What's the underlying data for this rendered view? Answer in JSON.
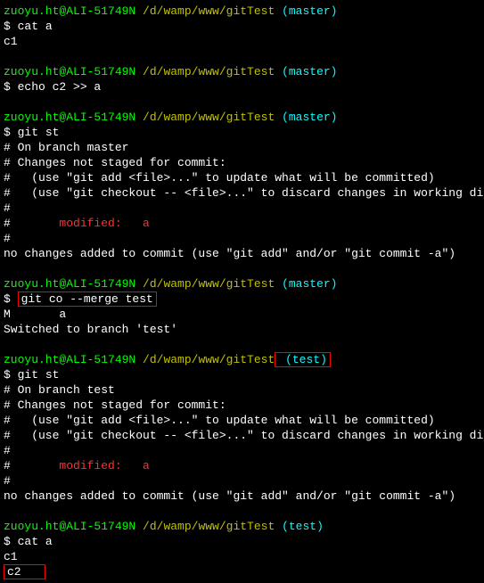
{
  "user": "zuoyu.ht@ALI-51749N",
  "path": " /d/wamp/www/gitTest",
  "branch_master": " (master)",
  "branch_test": " (test)",
  "dollar": "$ ",
  "blocks": {
    "b1": {
      "cmd": "cat a",
      "out1": "c1"
    },
    "b2": {
      "cmd": "echo c2 >> a"
    },
    "b3": {
      "cmd": "git st",
      "l1": "# On branch master",
      "l2": "# Changes not staged for commit:",
      "l3": "#   (use \"git add <file>...\" to update what will be committed)",
      "l4": "#   (use \"git checkout -- <file>...\" to discard changes in working directory)",
      "l5": "#",
      "l6_a": "#       ",
      "l6_b": "modified:   a",
      "l7": "#",
      "l8": "no changes added to commit (use \"git add\" and/or \"git commit -a\")"
    },
    "b4": {
      "cmd": "git co --merge test",
      "l1": "M       a",
      "l2": "Switched to branch 'test'"
    },
    "b5": {
      "cmd": "git st",
      "l1": "# On branch test",
      "l2": "# Changes not staged for commit:",
      "l3": "#   (use \"git add <file>...\" to update what will be committed)",
      "l4": "#   (use \"git checkout -- <file>...\" to discard changes in working directory)",
      "l5": "#",
      "l6_a": "#       ",
      "l6_b": "modified:   a",
      "l7": "#",
      "l8": "no changes added to commit (use \"git add\" and/or \"git commit -a\")"
    },
    "b6": {
      "cmd": "cat a",
      "out1": "c1",
      "out2": "c2"
    }
  }
}
